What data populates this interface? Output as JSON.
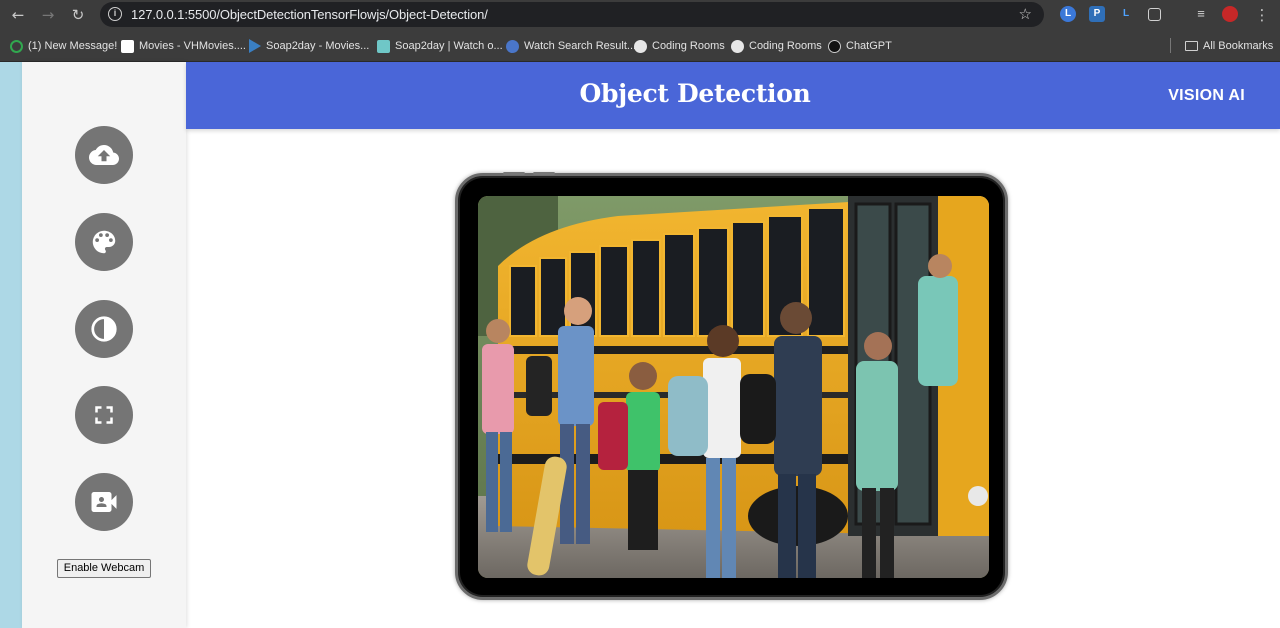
{
  "browser": {
    "url": "127.0.0.1:5500/ObjectDetectionTensorFlowjs/Object-Detection/",
    "bookmarks": [
      {
        "label": "(1) New Message!",
        "color": "#31a84f"
      },
      {
        "label": "Movies - VHMovies....",
        "color": "#ffffff"
      },
      {
        "label": "Soap2day - Movies...",
        "color": "#3a7fc2"
      },
      {
        "label": "Soap2day | Watch o...",
        "color": "#6fc7c7"
      },
      {
        "label": "Watch Search Result...",
        "color": "#4a76c9"
      },
      {
        "label": "Coding Rooms",
        "color": "#e6e6e6"
      },
      {
        "label": "Coding Rooms",
        "color": "#e6e6e6"
      },
      {
        "label": "ChatGPT",
        "color": "#111111"
      }
    ],
    "all_bookmarks_label": "All Bookmarks"
  },
  "header": {
    "title": "Object Detection",
    "brand": "VISION AI",
    "color": "#4a66d8"
  },
  "sidebar": {
    "tools": [
      {
        "icon": "cloud-upload-icon"
      },
      {
        "icon": "palette-icon"
      },
      {
        "icon": "contrast-icon"
      },
      {
        "icon": "fullscreen-icon"
      },
      {
        "icon": "video-camera-icon"
      }
    ],
    "webcam_button": "Enable Webcam"
  },
  "colors": {
    "left_strip": "#add8e6",
    "tool_button": "#757575"
  }
}
